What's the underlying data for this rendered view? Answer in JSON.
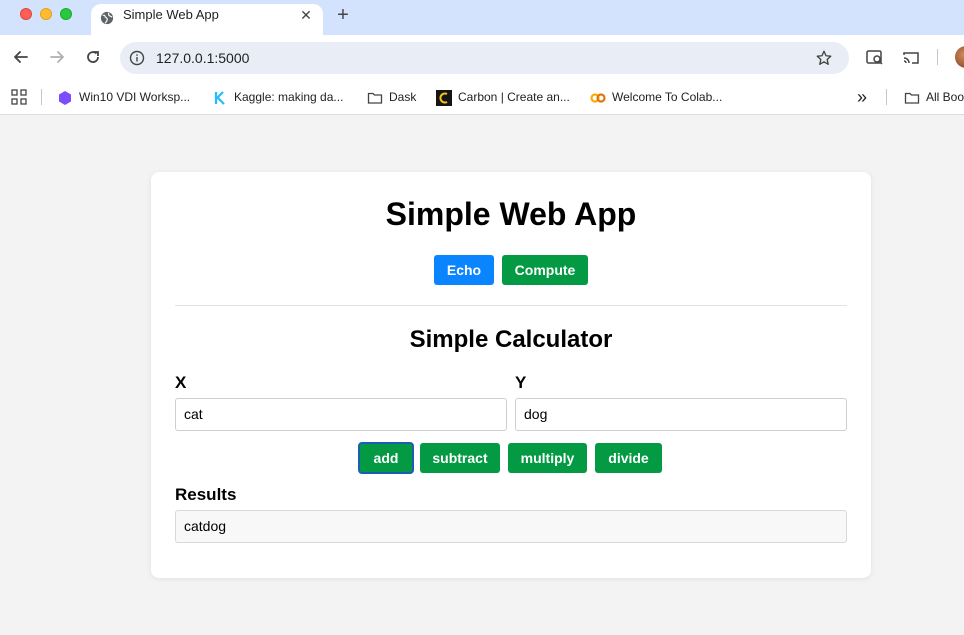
{
  "browser": {
    "tab": {
      "title": "Simple Web App",
      "close_glyph": "✕"
    },
    "new_tab_glyph": "+",
    "url": "127.0.0.1:5000",
    "bookmarks": [
      {
        "label": "Win10 VDI Worksp...",
        "icon": "hexagon-icon",
        "color": "#7b4dff"
      },
      {
        "label": "Kaggle: making da...",
        "icon": "kaggle-icon",
        "color": "#20beff"
      },
      {
        "label": "Dask",
        "icon": "folder-icon"
      },
      {
        "label": "Carbon | Create an...",
        "icon": "carbon-icon"
      },
      {
        "label": "Welcome To Colab...",
        "icon": "colab-icon",
        "color": "#f9ab00"
      }
    ],
    "overflow_glyph": "»",
    "all_bookmarks_label": "All Boo"
  },
  "app": {
    "title": "Simple Web App",
    "nav_buttons": {
      "echo": "Echo",
      "compute": "Compute"
    },
    "calculator": {
      "title": "Simple Calculator",
      "x_label": "X",
      "y_label": "Y",
      "x_value": "cat",
      "y_value": "dog",
      "ops": {
        "add": "add",
        "subtract": "subtract",
        "multiply": "multiply",
        "divide": "divide"
      },
      "results_label": "Results",
      "result_value": "catdog"
    }
  },
  "colors": {
    "primary_blue": "#0b84ff",
    "green": "#039a43",
    "tabbar": "#d3e3fd"
  }
}
